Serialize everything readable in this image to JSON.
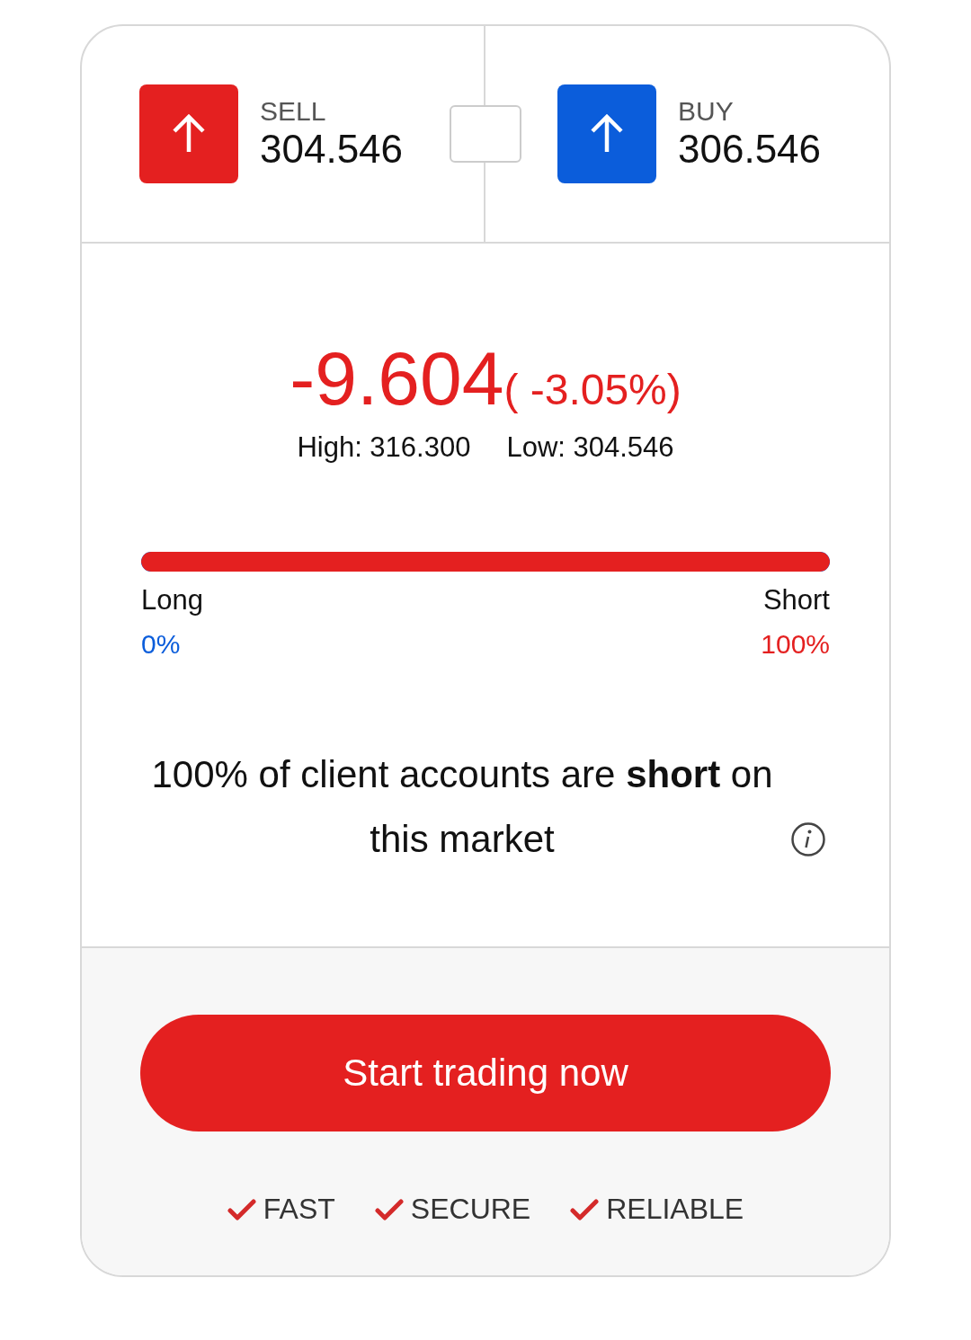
{
  "sides": [
    {
      "kind": "sell",
      "label": "SELL",
      "price": "304.546"
    },
    {
      "kind": "buy",
      "label": "BUY",
      "price": "306.546"
    }
  ],
  "change": {
    "value": "-9.604",
    "percent": "( -3.05%)",
    "high": "High: 316.300",
    "low": "Low: 304.546"
  },
  "sentiment": {
    "level": 1,
    "long_label": "Long",
    "long_value": "0%",
    "short_label": "Short",
    "short_value": "100%"
  },
  "statement": "100% of client accounts are **short** on this market",
  "cta": {
    "label": "Start trading now"
  },
  "features": [
    "FAST",
    "SECURE",
    "RELIABLE"
  ]
}
